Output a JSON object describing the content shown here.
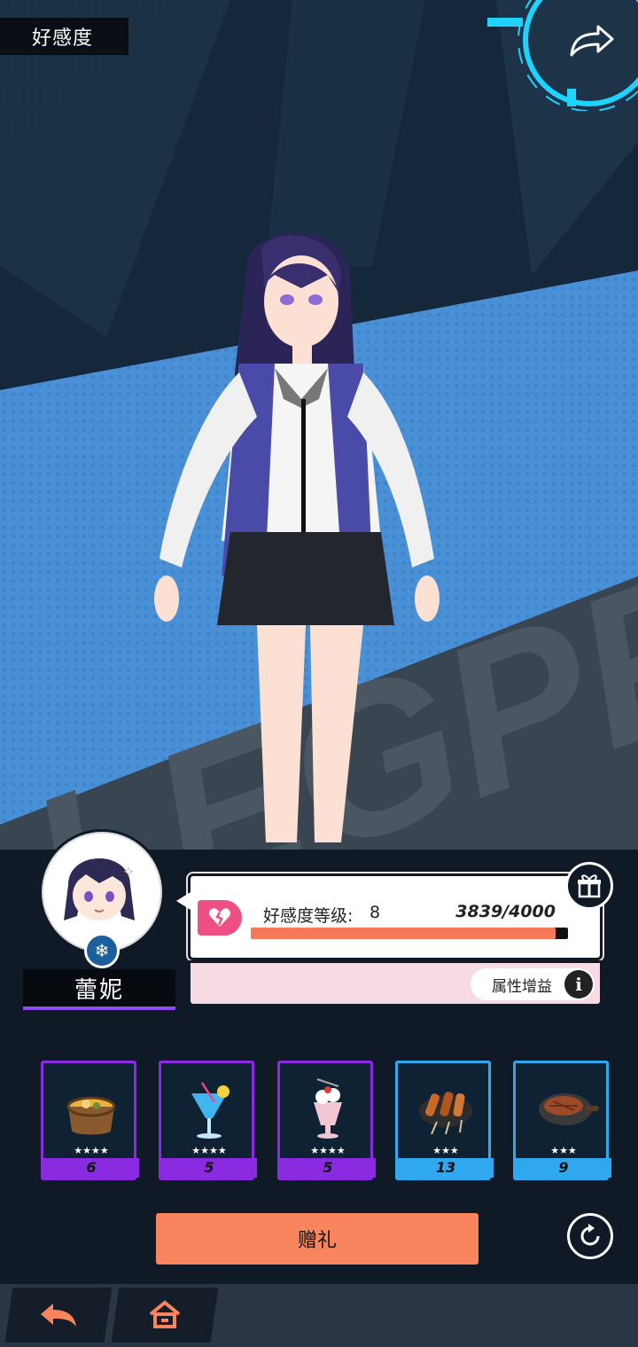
{
  "header": {
    "title": "好感度"
  },
  "character": {
    "name": "蕾妮",
    "element_icon": "snowflake-icon"
  },
  "affection": {
    "label": "好感度等级:",
    "level": "8",
    "exp_text": "3839/4000",
    "exp_fraction": 0.96
  },
  "attributes": {
    "label": "属性增益"
  },
  "gifts": [
    {
      "icon": "soup-pot-icon",
      "stars": "★★★★",
      "count": "6",
      "rarity_color": "#8a2be2"
    },
    {
      "icon": "blue-cocktail-icon",
      "stars": "★★★★",
      "count": "5",
      "rarity_color": "#8a2be2"
    },
    {
      "icon": "parfait-icon",
      "stars": "★★★★",
      "count": "5",
      "rarity_color": "#8a2be2"
    },
    {
      "icon": "skewers-icon",
      "stars": "★★★",
      "count": "13",
      "rarity_color": "#2fa8f0"
    },
    {
      "icon": "steak-icon",
      "stars": "★★★",
      "count": "9",
      "rarity_color": "#2fa8f0"
    }
  ],
  "actions": {
    "give_gift_label": "赠礼"
  },
  "colors": {
    "accent": "#f9855f",
    "epic": "#8a2be2",
    "rare": "#2fa8f0",
    "heart": "#ee4f84"
  }
}
